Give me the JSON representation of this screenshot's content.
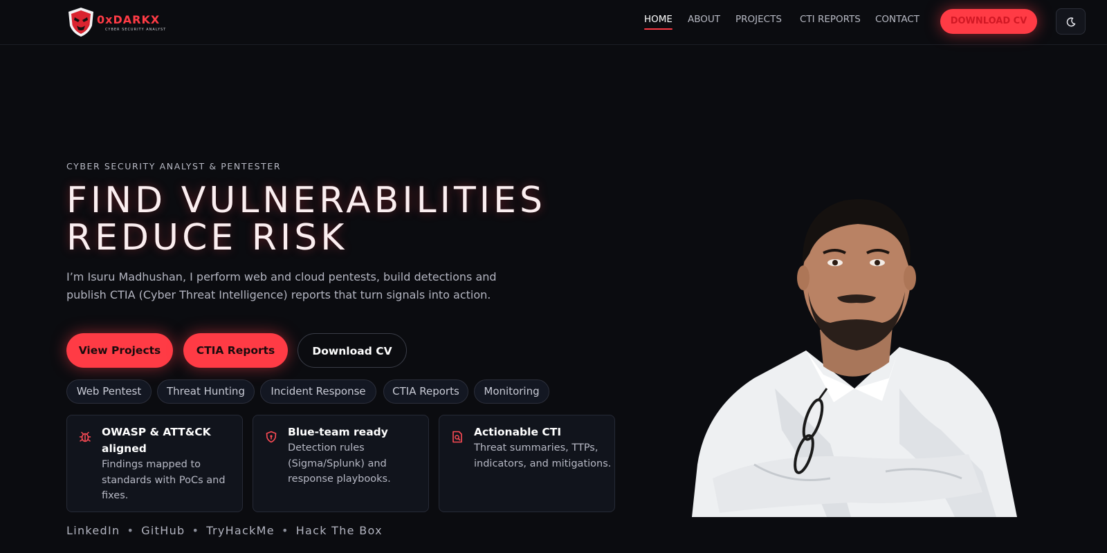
{
  "brand": {
    "name": "0xDARKX",
    "tagline": "CYBER SECURITY ANALYST"
  },
  "nav": {
    "items": [
      {
        "label": "HOME",
        "active": true
      },
      {
        "label": "ABOUT",
        "active": false
      },
      {
        "label": "PROJECTS",
        "active": false
      },
      {
        "label": "CTI REPORTS",
        "active": false
      },
      {
        "label": "CONTACT",
        "active": false
      }
    ],
    "cta_label": "DOWNLOAD CV",
    "theme_icon": "moon-icon"
  },
  "hero": {
    "eyebrow": "CYBER SECURITY ANALYST & PENTESTER",
    "headline_line1": "FIND VULNERABILITIES",
    "headline_line2": "REDUCE RISK",
    "intro": "I’m Isuru Madhushan, I perform web and cloud pentests, build detections and publish CTIA (Cyber Threat Intelligence) reports that turn signals into action.",
    "buttons": [
      {
        "label": "View Projects",
        "style": "primary"
      },
      {
        "label": "CTIA Reports",
        "style": "primary"
      },
      {
        "label": "Download CV",
        "style": "outline"
      }
    ],
    "tags": [
      "Web Pentest",
      "Threat Hunting",
      "Incident Response",
      "CTIA Reports",
      "Monitoring"
    ],
    "cards": [
      {
        "icon": "bug-icon",
        "title": "OWASP & ATT&CK aligned",
        "text": "Findings mapped to standards with PoCs and fixes."
      },
      {
        "icon": "shield-lock-icon",
        "title": "Blue-team ready",
        "text": "Detection rules (Sigma/Splunk) and response playbooks."
      },
      {
        "icon": "search-report-icon",
        "title": "Actionable CTI",
        "text": "Threat summaries, TTPs, indicators, and mitigations."
      }
    ],
    "social": [
      "LinkedIn",
      "GitHub",
      "TryHackMe",
      "Hack The Box"
    ],
    "social_separator": "•"
  },
  "colors": {
    "accent": "#ff3b45",
    "background": "#0b0c10",
    "card_bg": "#11141c"
  }
}
